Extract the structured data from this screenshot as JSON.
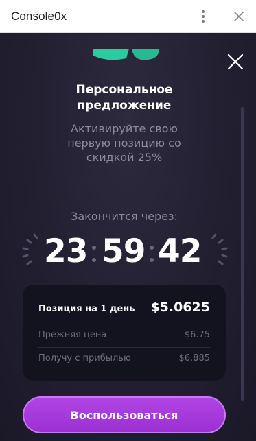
{
  "window": {
    "title": "Console0x",
    "more_icon": "more-vertical-icon",
    "close_icon": "close-icon"
  },
  "offer": {
    "heading": "Персональное предложение",
    "subtext": "Активируйте свою первую позицию со скидкой 25%",
    "ends_label": "Закончится через:",
    "timer": {
      "hours": "23",
      "minutes": "59",
      "seconds": "42"
    },
    "card": {
      "main_label": "Позиция на 1 день",
      "main_value": "$5.0625",
      "old_price_label": "Прежняя цена",
      "old_price_value": "$6.75",
      "profit_label": "Получу с прибылью",
      "profit_value": "$6.885"
    },
    "cta_label": "Воспользоваться"
  },
  "colors": {
    "accent": "#a73be0",
    "mint": "#2ec9a0",
    "panel_bg": "#221f31"
  }
}
